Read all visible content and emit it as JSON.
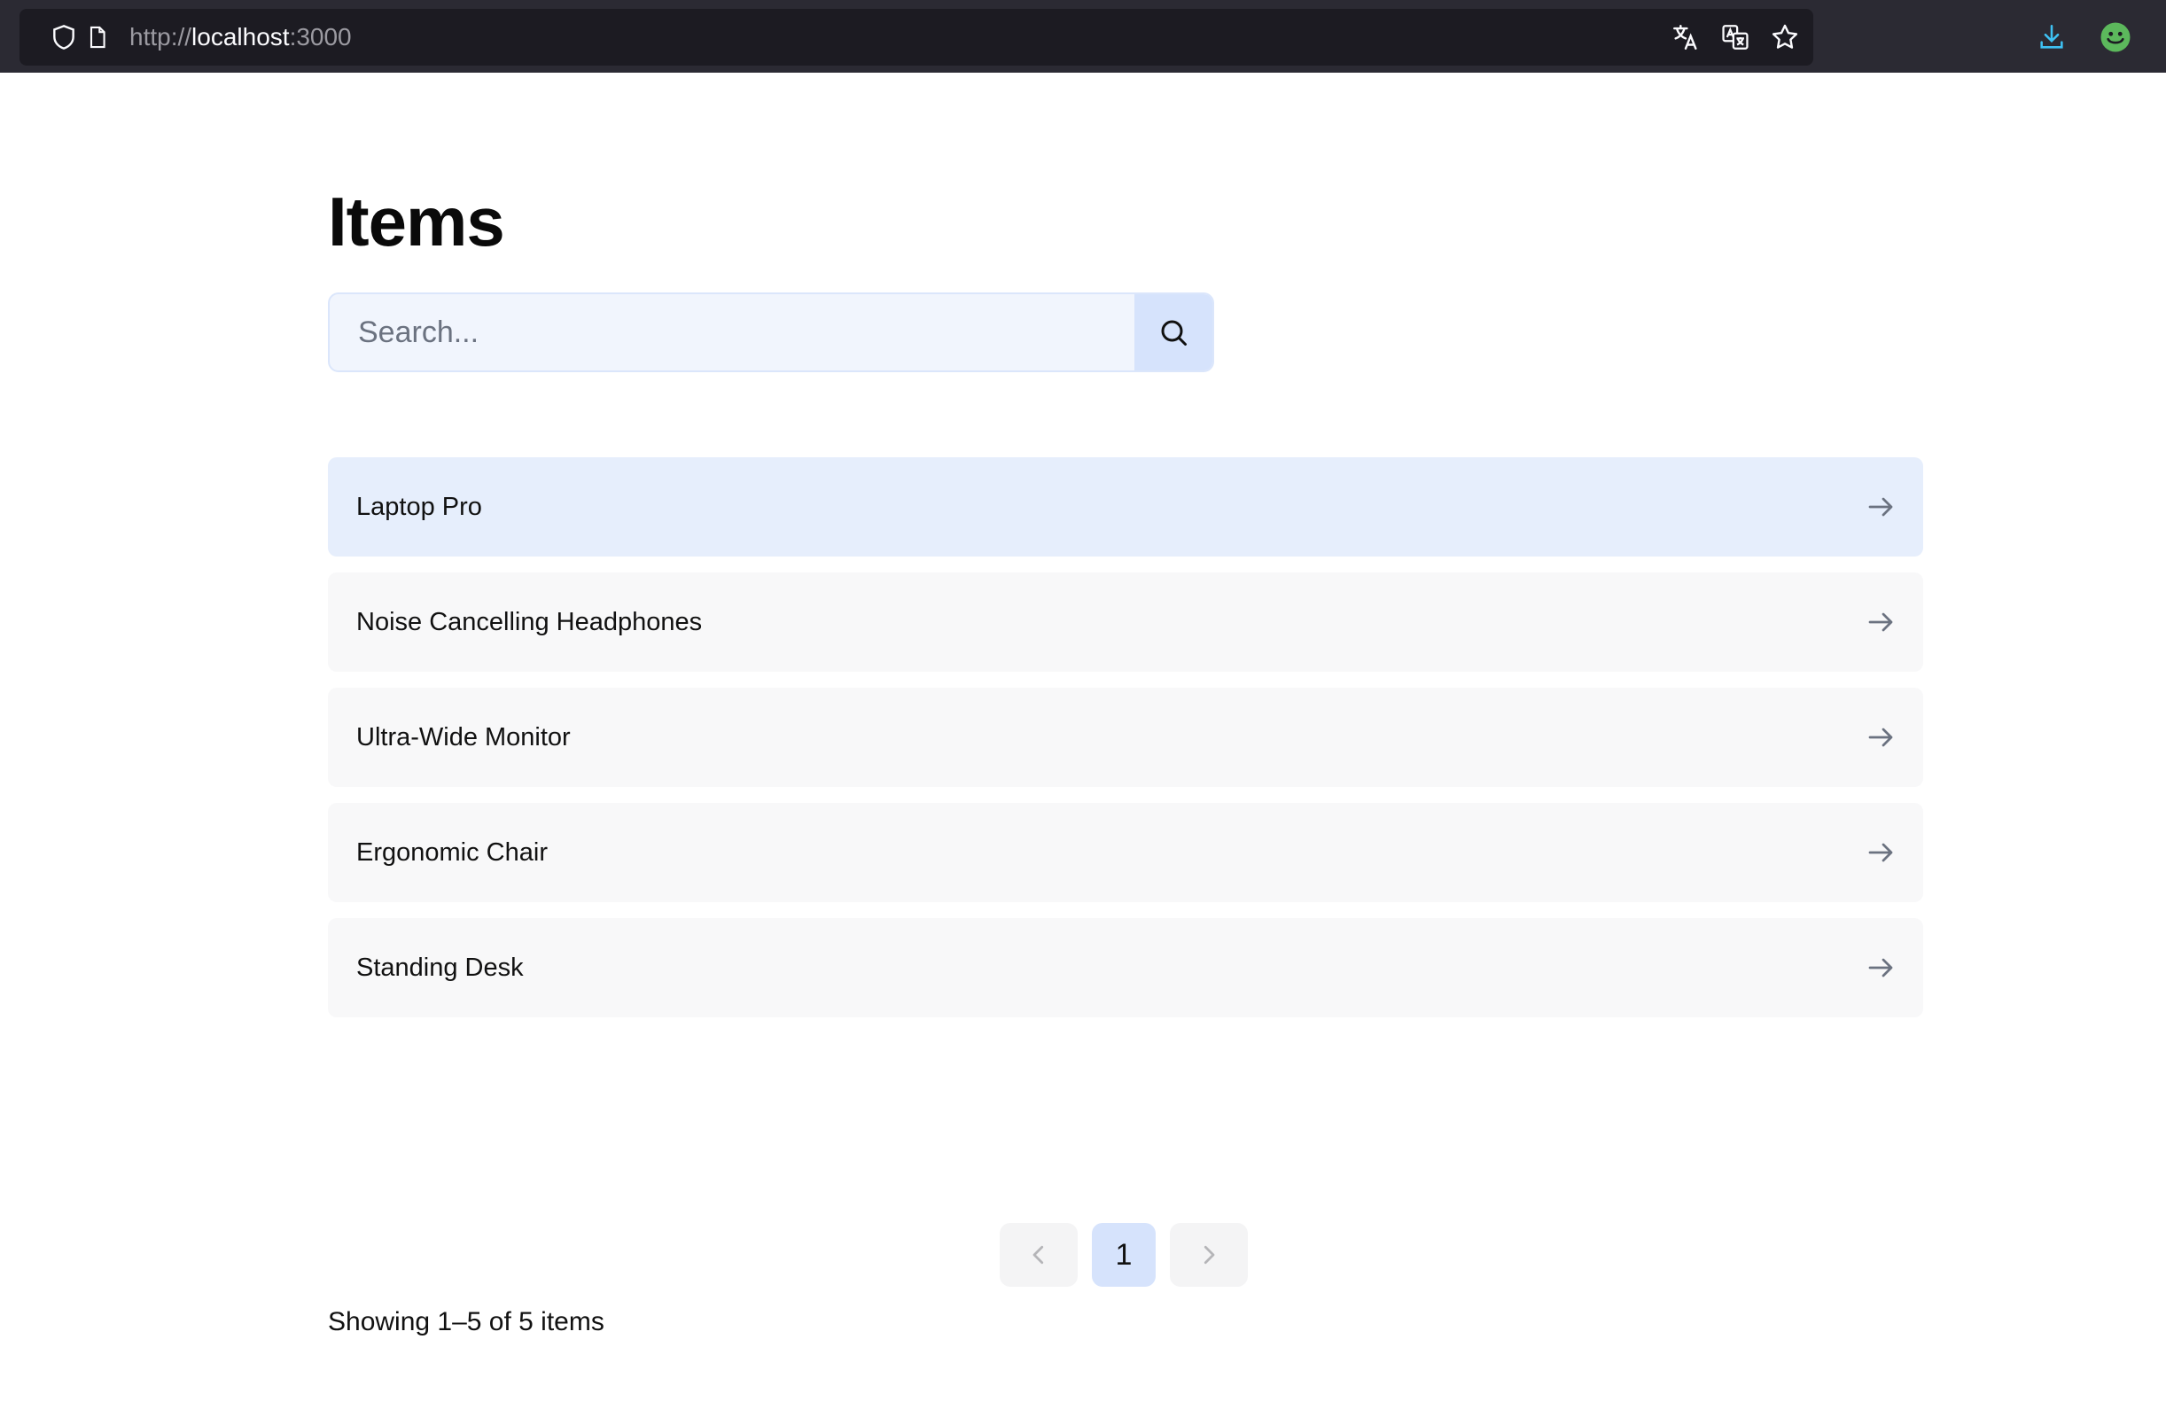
{
  "browser": {
    "url_scheme": "http://",
    "url_host": "localhost",
    "url_port": ":3000",
    "icons": [
      "shield-icon",
      "page-icon",
      "translate-icon",
      "translate-page-icon",
      "bookmark-star-icon",
      "download-icon",
      "profile-avatar-icon"
    ]
  },
  "page": {
    "title": "Items",
    "search": {
      "placeholder": "Search...",
      "value": ""
    }
  },
  "items": [
    {
      "label": "Laptop Pro",
      "active": true
    },
    {
      "label": "Noise Cancelling Headphones",
      "active": false
    },
    {
      "label": "Ultra-Wide Monitor",
      "active": false
    },
    {
      "label": "Ergonomic Chair",
      "active": false
    },
    {
      "label": "Standing Desk",
      "active": false
    }
  ],
  "pagination": {
    "current_page": "1",
    "summary": "Showing 1–5 of 5 items"
  },
  "colors": {
    "accent_light": "#d6e3fc",
    "active_row": "#e6eefc",
    "row": "#f8f8f9",
    "chrome": "#2b2a33"
  }
}
